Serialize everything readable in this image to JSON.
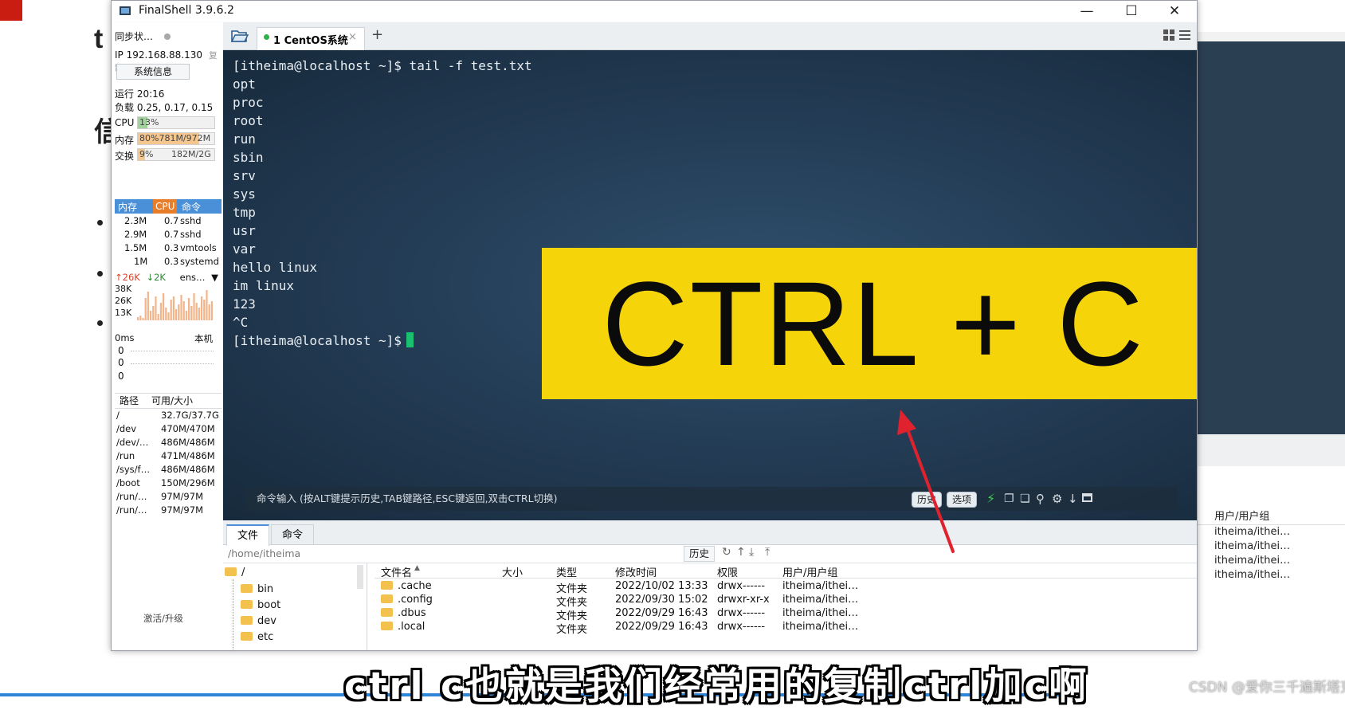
{
  "window": {
    "title": "FinalShell 3.9.6.2"
  },
  "sidebar": {
    "sync_status": "同步状…",
    "ip": "IP 192.168.88.130",
    "copy_label": "复制",
    "sysinfo_button": "系统信息",
    "uptime": "运行 20:16",
    "load": "负载 0.25, 0.17, 0.15",
    "cpu_label": "CPU",
    "cpu_value": "13%",
    "cpu_fraction": 0.13,
    "mem_label": "内存",
    "mem_value": "80%781M/972M",
    "mem_fraction": 0.8,
    "swap_label": "交换",
    "swap_value": "9%",
    "swap_size": "182M/2G",
    "swap_fraction": 0.09,
    "proc_headers": [
      "内存",
      "CPU",
      "命令"
    ],
    "processes": [
      {
        "mem": "2.3M",
        "cpu": "0.7",
        "cmd": "sshd"
      },
      {
        "mem": "2.9M",
        "cpu": "0.7",
        "cmd": "sshd"
      },
      {
        "mem": "1.5M",
        "cpu": "0.3",
        "cmd": "vmtools"
      },
      {
        "mem": "1M",
        "cpu": "0.3",
        "cmd": "systemd"
      }
    ],
    "net_up": "↑26K",
    "net_down": "↓2K",
    "net_iface": "ens…",
    "net_scale": [
      "38K",
      "26K",
      "13K"
    ],
    "ping_label": "0ms",
    "ping_host": "本机",
    "ping_values": [
      "0",
      "0",
      "0"
    ],
    "disk_headers": [
      "路径",
      "可用/大小"
    ],
    "disks": [
      {
        "path": "/",
        "size": "32.7G/37.7G"
      },
      {
        "path": "/dev",
        "size": "470M/470M"
      },
      {
        "path": "/dev/…",
        "size": "486M/486M"
      },
      {
        "path": "/run",
        "size": "471M/486M"
      },
      {
        "path": "/sys/f…",
        "size": "486M/486M"
      },
      {
        "path": "/boot",
        "size": "150M/296M"
      },
      {
        "path": "/run/…",
        "size": "97M/97M"
      },
      {
        "path": "/run/…",
        "size": "97M/97M"
      }
    ],
    "activate_link": "激活/升级"
  },
  "tabs": {
    "active_label": "1 CentOS系统"
  },
  "terminal": {
    "lines": [
      "[itheima@localhost ~]$ tail -f test.txt",
      "opt",
      "proc",
      "root",
      "run",
      "sbin",
      "srv",
      "sys",
      "tmp",
      "usr",
      "var",
      "hello linux",
      "im linux",
      "123",
      "^C"
    ],
    "prompt": "[itheima@localhost ~]$",
    "overlay": "CTRL + C",
    "cmd_hint": "命令输入 (按ALT键提示历史,TAB键路径,ESC键返回,双击CTRL切换)",
    "history_button": "历史",
    "options_button": "选项"
  },
  "files": {
    "tab_files": "文件",
    "tab_commands": "命令",
    "path": "/home/itheima",
    "history_button": "历史",
    "tree_root": "/",
    "tree": [
      "bin",
      "boot",
      "dev",
      "etc"
    ],
    "columns": [
      "文件名",
      "大小",
      "类型",
      "修改时间",
      "权限",
      "用户/用户组"
    ],
    "rows": [
      {
        "name": ".cache",
        "type": "文件夹",
        "mtime": "2022/10/02 13:33",
        "perm": "drwx------",
        "owner": "itheima/ithei…"
      },
      {
        "name": ".config",
        "type": "文件夹",
        "mtime": "2022/09/30 15:02",
        "perm": "drwxr-xr-x",
        "owner": "itheima/ithei…"
      },
      {
        "name": ".dbus",
        "type": "文件夹",
        "mtime": "2022/09/29 16:43",
        "perm": "drwx------",
        "owner": "itheima/ithei…"
      },
      {
        "name": ".local",
        "type": "文件夹",
        "mtime": "2022/09/29 16:43",
        "perm": "drwx------",
        "owner": "itheima/ithei…"
      }
    ]
  },
  "background": {
    "right_header": "用户/用户组",
    "right_rows": [
      "itheima/ithei…",
      "itheima/ithei…",
      "itheima/ithei…",
      "itheima/ithei…"
    ]
  },
  "subtitle": "ctrl c也就是我们经常用的复制ctrl加c啊",
  "watermark": "CSDN @爱你三千遍斯塔克",
  "colors": {
    "banner": "#f6d40a",
    "arrow": "#e0222e",
    "cursor": "#18c070",
    "accent": "#4a90d9"
  }
}
